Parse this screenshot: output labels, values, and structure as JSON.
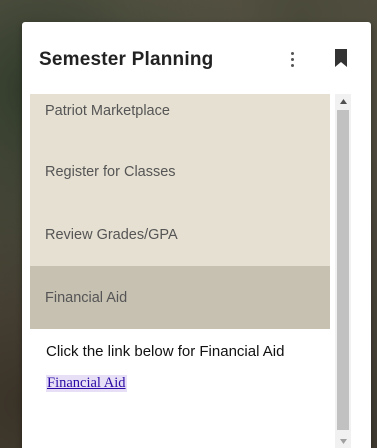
{
  "card": {
    "title": "Semester Planning",
    "more_icon": "more-vert-icon",
    "bookmark_icon": "bookmark-icon"
  },
  "menu": {
    "items": [
      {
        "label": "Patriot Marketplace"
      },
      {
        "label": "Register for Classes"
      },
      {
        "label": "Review Grades/GPA"
      },
      {
        "label": "Financial Aid"
      }
    ],
    "active_index": 3
  },
  "detail": {
    "description": "Click the link below for Financial Aid",
    "link_text": "Financial Aid"
  },
  "colors": {
    "menu_bg": "#e6e0d2",
    "menu_active_bg": "#c7c1b2",
    "link": "#2b0aa6"
  }
}
